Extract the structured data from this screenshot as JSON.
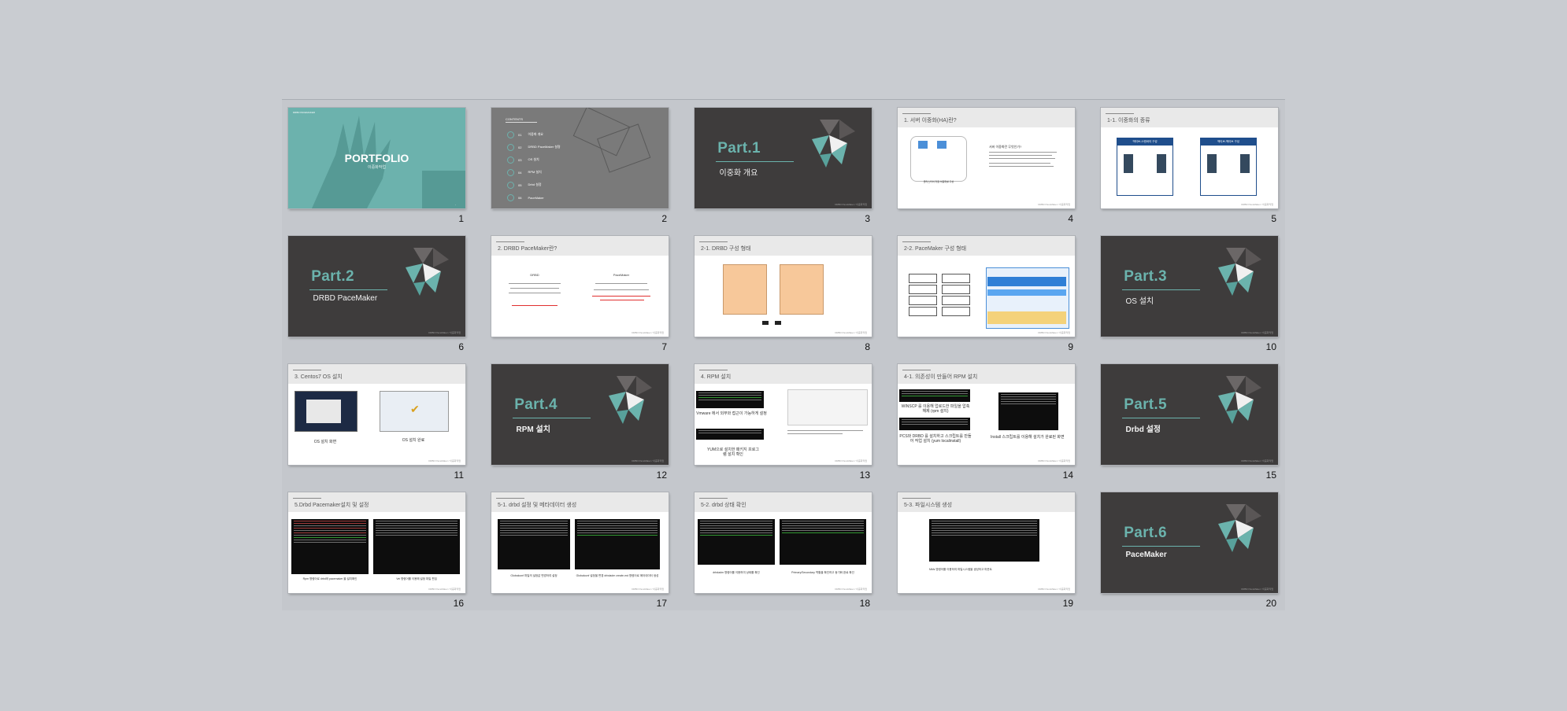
{
  "slides": [
    {
      "n": "1",
      "kind": "cover",
      "title": "PORTFOLIO",
      "sub": "이중화작업",
      "mini": "DRBD PACEMAKER",
      "foot": "-"
    },
    {
      "n": "2",
      "kind": "toc",
      "heading": "CONTENTS",
      "items": [
        {
          "no": "01",
          "label": "이중화 개요"
        },
        {
          "no": "02",
          "label": "DRBD PaceMaker 설명"
        },
        {
          "no": "03",
          "label": "OS 설치"
        },
        {
          "no": "04",
          "label": "RPM 설치"
        },
        {
          "no": "05",
          "label": "Drbd 설정"
        },
        {
          "no": "06",
          "label": "PaceMaker"
        }
      ]
    },
    {
      "n": "3",
      "kind": "part",
      "part": "Part.1",
      "sub": "이중화 개요"
    },
    {
      "n": "4",
      "kind": "content",
      "title": "1. 서버 이중화(HA)란?",
      "cap1": "클러스터의 자원 이중화를 구성",
      "cap2": "서버 이중화란 무엇인가?"
    },
    {
      "n": "5",
      "kind": "content",
      "title": "1-1. 이중화의 종류",
      "cap1": "액티브-스탠바이 구성",
      "cap2": "액티브-액티브 구성"
    },
    {
      "n": "6",
      "kind": "part",
      "part": "Part.2",
      "sub": "DRBD PaceMaker"
    },
    {
      "n": "7",
      "kind": "content",
      "title": "2. DRBD PaceMaker란?",
      "cap1": "DRBD",
      "cap2": "PaceMaker"
    },
    {
      "n": "8",
      "kind": "content",
      "title": "2-1. DRBD 구성 형태"
    },
    {
      "n": "9",
      "kind": "content",
      "title": "2-2. PaceMaker 구성 형태"
    },
    {
      "n": "10",
      "kind": "part",
      "part": "Part.3",
      "sub": "OS 설치"
    },
    {
      "n": "11",
      "kind": "content",
      "title": "3. Centos7 OS 설치",
      "cap1": "OS 설치 화면",
      "cap2": "OS 설치 완료"
    },
    {
      "n": "12",
      "kind": "part",
      "part": "Part.4",
      "sub": "RPM 설치"
    },
    {
      "n": "13",
      "kind": "content",
      "title": "4. RPM 설치",
      "cap1": "Vmware 에서 외부와 접근이 가능하게 설정",
      "cap2": "YUM으로 설치한 패키지 프로그램 설치 확인"
    },
    {
      "n": "14",
      "kind": "content",
      "title": "4-1. 의존성이 만들어 RPM 설치",
      "cap1": "WINSCP 를 이용해 업로드한 파일을 압축 해제 (rpm 설치)",
      "cap2": "PCS와 DRBD 를 설치하고 스크립트를 만들어 작업 설치 (yum localinstall)",
      "cap3": "Install 스크립트를 이용해 설치가 완료된 화면"
    },
    {
      "n": "15",
      "kind": "part",
      "part": "Part.5",
      "sub": "Drbd 설정"
    },
    {
      "n": "16",
      "kind": "content",
      "title": "5.Drbd Pacemaker설치 및 설정",
      "cap1": "Rpm 명령어로 drbd와 pacemaker 을 설치확인",
      "cap2": "Vei 명령어를 이용해 설정 파일 편집"
    },
    {
      "n": "17",
      "kind": "content",
      "title": "5-1. drbd 설정 및 메타데이터 생성",
      "cap1": "Globalconf 파일의 설정값 변경하여 설정",
      "cap2": "Globalconf 설정을 변경 drbdadm create-md 명령어로 메타데이터 생성"
    },
    {
      "n": "18",
      "kind": "content",
      "title": "5-2. drbd 상태 확인",
      "cap1": "drbdadm 명령어를 이용하여 상태를 확인",
      "cap2": "Primary/Secondary 역할을 확인하고 동기화 완료 확인"
    },
    {
      "n": "19",
      "kind": "content",
      "title": "5-3. 파일시스템 생성",
      "cap1": "Mkfs 명령어를 이용하여 파일시스템을 생성하고 마운트"
    },
    {
      "n": "20",
      "kind": "part",
      "part": "Part.6",
      "sub": "PaceMaker"
    }
  ],
  "footer_text": "DRBD PaceMaker / 이중화작업",
  "colors": {
    "accent": "#6bb3ad",
    "dark": "#3e3c3c",
    "teal": "#6cb2ad",
    "background": "#c9ccd1"
  }
}
